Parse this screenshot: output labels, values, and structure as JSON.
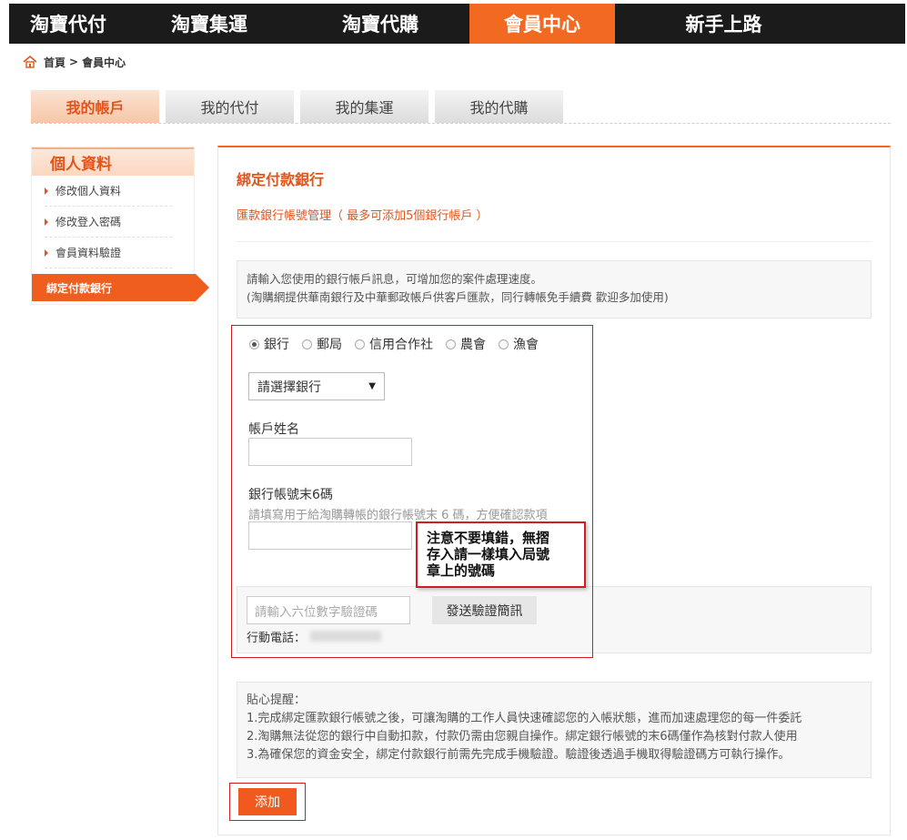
{
  "topnav": [
    {
      "label": "淘寶代付",
      "active": false
    },
    {
      "label": "淘寶集運",
      "active": false
    },
    {
      "label": "淘寶代購",
      "active": false
    },
    {
      "label": "會員中心",
      "active": true
    },
    {
      "label": "新手上路",
      "active": false
    }
  ],
  "breadcrumb": {
    "home": "首頁",
    "separator": ">",
    "current": "會員中心"
  },
  "tabs": [
    "我的帳戶",
    "我的代付",
    "我的集運",
    "我的代購"
  ],
  "sidebar": {
    "title": "個人資料",
    "items": [
      "修改個人資料",
      "修改登入密碼",
      "會員資料驗證"
    ],
    "active": "綁定付款銀行"
  },
  "panel": {
    "title": "綁定付款銀行",
    "subtitle": "匯款銀行帳號管理（ 最多可添加5個銀行帳戶 ）",
    "notice_line1": "請輸入您使用的銀行帳戶訊息，可增加您的案件處理速度。",
    "notice_line2": "(淘購網提供華南銀行及中華郵政帳戶供客戶匯款，同行轉帳免手續費 歡迎多加使用)"
  },
  "form": {
    "radios": [
      {
        "label": "銀行",
        "checked": true
      },
      {
        "label": "郵局",
        "checked": false
      },
      {
        "label": "信用合作社",
        "checked": false
      },
      {
        "label": "農會",
        "checked": false
      },
      {
        "label": "漁會",
        "checked": false
      }
    ],
    "bank_select": "請選擇銀行",
    "account_name_label": "帳戶姓名",
    "account_last6_label": "銀行帳號末6碼",
    "account_last6_hint": "請填寫用于給淘購轉帳的銀行帳號末 6 碼，方便確認款項",
    "code_placeholder": "請輸入六位數字驗證碼",
    "send_button": "發送驗證簡訊",
    "mobile_label": "行動電話："
  },
  "tips": {
    "title": "貼心提醒：",
    "lines": [
      "1.完成綁定匯款銀行帳號之後，可讓淘購的工作人員快速確認您的入帳狀態，進而加速處理您的每一件委託",
      "2.淘購無法從您的銀行中自動扣款，付款仍需由您親自操作。綁定銀行帳號的末6碼僅作為核對付款人使用",
      "3.為確保您的資金安全，綁定付款銀行前需先完成手機驗證。驗證後透過手機取得驗證碼方可執行操作。"
    ]
  },
  "add_button": "添加",
  "annotation": {
    "line1": "注意不要填錯，無摺",
    "line2": "存入請一樣填入局號",
    "line3": "章上的號碼"
  },
  "colors": {
    "accent": "#f26a21",
    "nav_bg": "#1b1b1b",
    "annotation": "#d11f1f"
  }
}
